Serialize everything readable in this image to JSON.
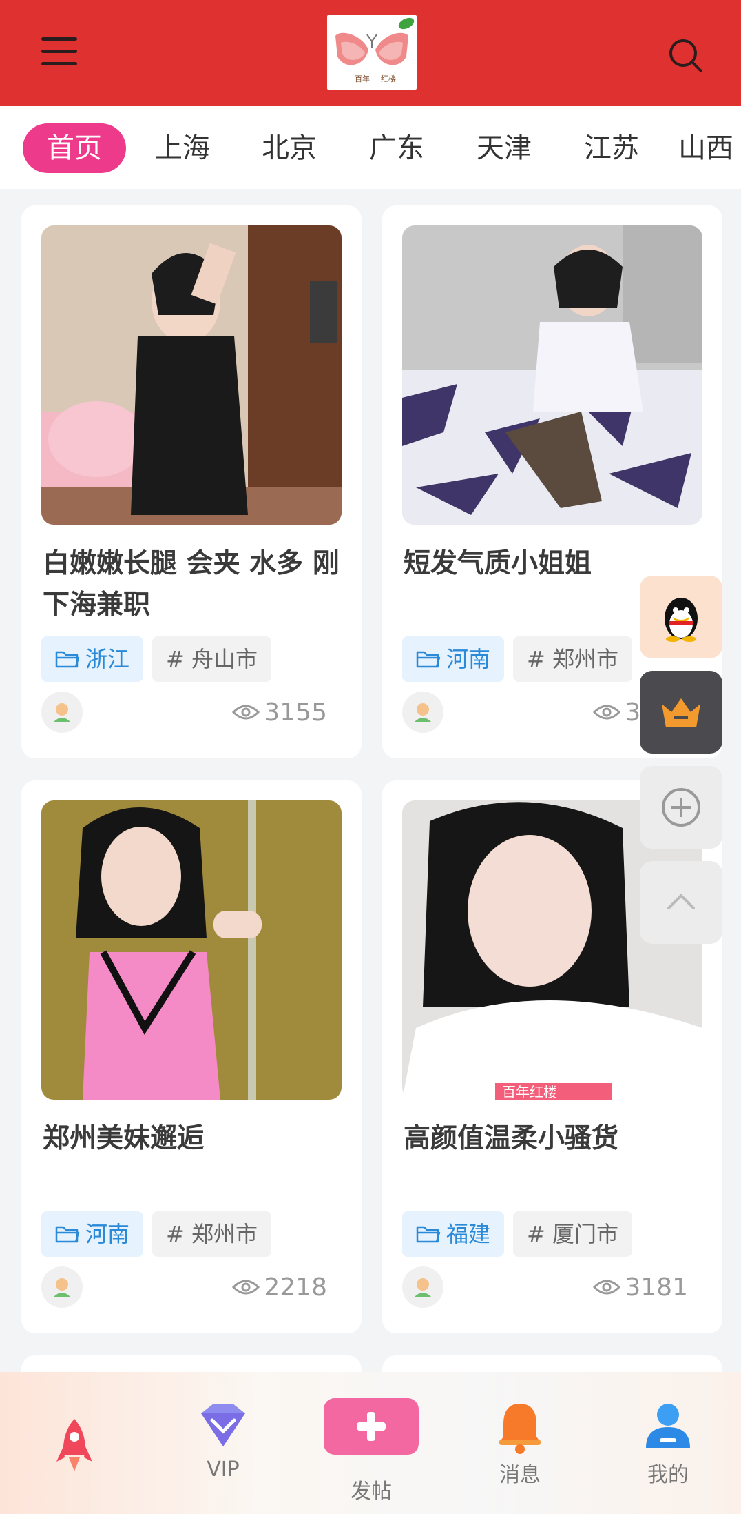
{
  "header": {
    "logo_text_1": "百年",
    "logo_text_2": "红楼"
  },
  "tabs": [
    "首页",
    "上海",
    "北京",
    "广东",
    "天津",
    "江苏",
    "山西"
  ],
  "cards": [
    {
      "title": "白嫩嫩长腿 会夹 水多 刚下海兼职",
      "province": "浙江",
      "city": "# 舟山市",
      "views": "3155"
    },
    {
      "title": "短发气质小姐姐",
      "province": "河南",
      "city": "# 郑州市",
      "views": "3231"
    },
    {
      "title": "郑州美妹邂逅",
      "province": "河南",
      "city": "# 郑州市",
      "views": "2218"
    },
    {
      "title": "高颜值温柔小骚货",
      "province": "福建",
      "city": "# 厦门市",
      "views": "3181"
    }
  ],
  "photo_caption": "百年红楼",
  "float_buttons": [
    "qq-icon",
    "crown-icon",
    "add-circle-icon",
    "chevron-up-icon"
  ],
  "bottom_nav": {
    "home": "",
    "vip": "VIP",
    "post": "发帖",
    "messages": "消息",
    "mine": "我的"
  },
  "colors": {
    "header_red": "#e03131",
    "tab_active_pink": "#ee3a8a",
    "tag_blue": "#2b8ad8"
  }
}
